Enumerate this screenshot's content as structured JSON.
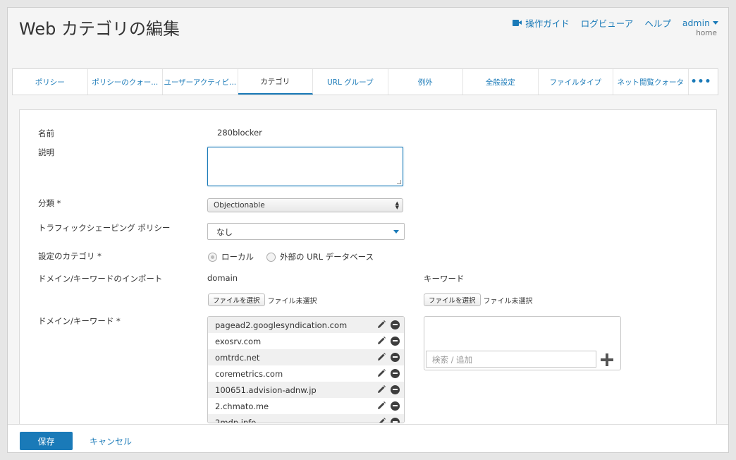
{
  "header": {
    "title": "Web カテゴリの編集",
    "guide_label": "操作ガイド",
    "log_viewer_label": "ログビューア",
    "help_label": "ヘルプ",
    "user_label": "admin",
    "home_label": "home",
    "accent_color": "#1a7ab8"
  },
  "tabs": [
    {
      "label": "ポリシー"
    },
    {
      "label": "ポリシーのクォー..."
    },
    {
      "label": "ユーザーアクティビ..."
    },
    {
      "label": "カテゴリ",
      "active": true
    },
    {
      "label": "URL グループ"
    },
    {
      "label": "例外"
    },
    {
      "label": "全般設定"
    },
    {
      "label": "ファイルタイプ"
    },
    {
      "label": "ネット閲覧クォータ"
    },
    {
      "label": "•••"
    }
  ],
  "form": {
    "name_label": "名前",
    "name_value": "280blocker",
    "description_label": "説明",
    "classification_label": "分類 *",
    "classification_value": "Objectionable",
    "traffic_label": "トラフィックシェーピング ポリシー",
    "traffic_value": "なし",
    "category_setting_label": "設定のカテゴリ *",
    "radio_local": "ローカル",
    "radio_external": "外部の URL データベース",
    "import_label": "ドメイン/キーワードのインポート",
    "domain_heading": "domain",
    "keyword_heading": "キーワード",
    "file_button": "ファイルを選択",
    "file_status": "ファイル未選択",
    "domain_keyword_label": "ドメイン/キーワード *",
    "keyword_placeholder": "検索 / 追加"
  },
  "domains": [
    "pagead2.googlesyndication.com",
    "exosrv.com",
    "omtrdc.net",
    "coremetrics.com",
    "100651.advision-adnw.jp",
    "2.chmato.me",
    "2mdn.info"
  ],
  "footer": {
    "save_label": "保存",
    "cancel_label": "キャンセル"
  }
}
